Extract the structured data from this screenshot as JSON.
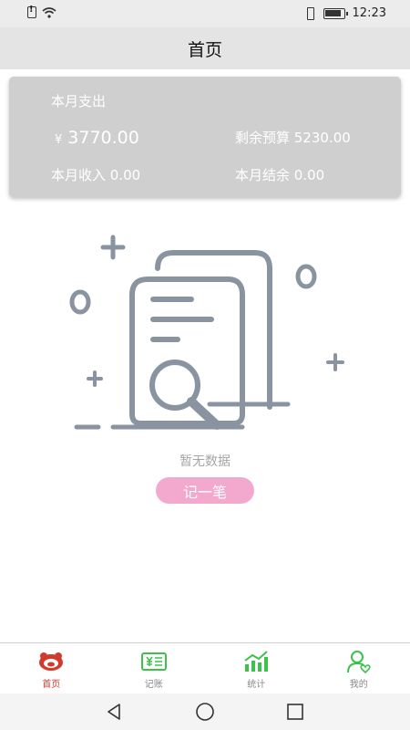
{
  "status_bar": {
    "time": "12:23"
  },
  "header": {
    "title": "首页"
  },
  "summary": {
    "title": "本月支出",
    "currency": "¥",
    "amount": "3770.00",
    "budget_label": "剩余预算 5230.00",
    "income_label": "本月收入 0.00",
    "balance_label": "本月结余 0.00"
  },
  "empty_state": {
    "message": "暂无数据",
    "button_label": "记一笔"
  },
  "tabs": [
    {
      "label": "首页",
      "icon": "home-piggy-icon",
      "active": true
    },
    {
      "label": "记账",
      "icon": "bill-yuan-icon",
      "active": false
    },
    {
      "label": "统计",
      "icon": "chart-trend-icon",
      "active": false
    },
    {
      "label": "我的",
      "icon": "user-heart-icon",
      "active": false
    }
  ],
  "colors": {
    "accent_pink": "#f3a9ce",
    "active_tab": "#d23a2d",
    "tab_green": "#3cc24a"
  }
}
